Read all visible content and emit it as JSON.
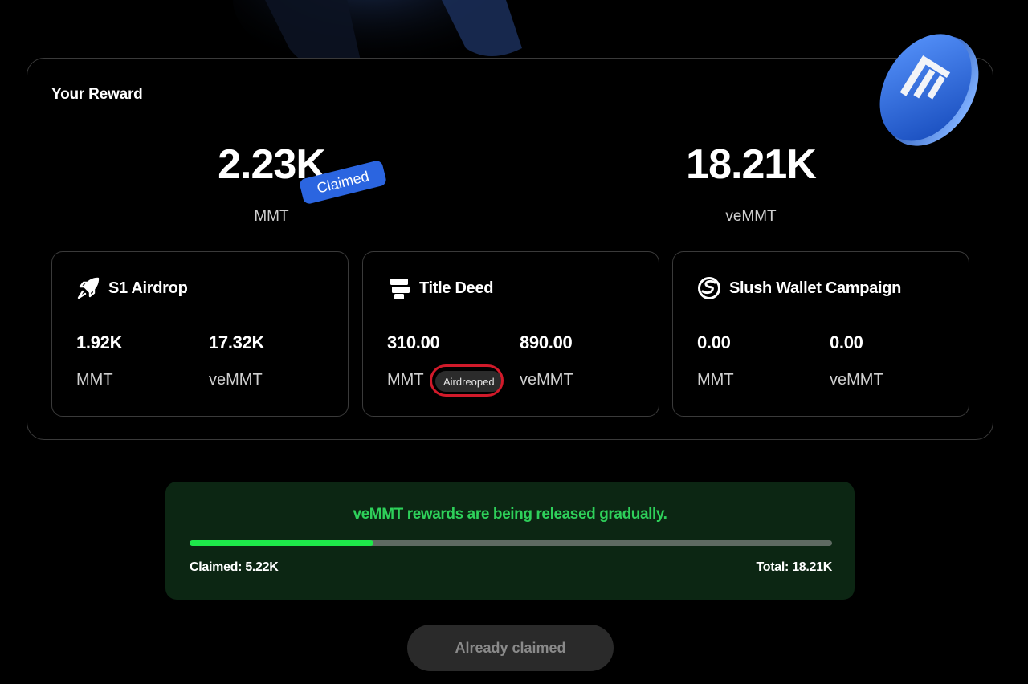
{
  "reward": {
    "title": "Your Reward",
    "mmt_value": "2.23K",
    "mmt_unit": "MMT",
    "claimed_badge": "Claimed",
    "vemmt_value": "18.21K",
    "vemmt_unit": "veMMT"
  },
  "cards": [
    {
      "title": "S1 Airdrop",
      "icon": "rocket-icon",
      "mmt": "1.92K",
      "mmt_unit": "MMT",
      "vemmt": "17.32K",
      "vemmt_unit": "veMMT"
    },
    {
      "title": "Title Deed",
      "icon": "signpost-icon",
      "mmt": "310.00",
      "mmt_unit": "MMT",
      "badge": "Airdreoped",
      "vemmt": "890.00",
      "vemmt_unit": "veMMT"
    },
    {
      "title": "Slush Wallet Campaign",
      "icon": "slush-icon",
      "mmt": "0.00",
      "mmt_unit": "MMT",
      "vemmt": "0.00",
      "vemmt_unit": "veMMT"
    }
  ],
  "progress": {
    "message": "veMMT rewards are being released gradually.",
    "claimed_label": "Claimed: 5.22K",
    "total_label": "Total: 18.21K",
    "fraction": 0.2866
  },
  "button": {
    "label": "Already claimed"
  },
  "colors": {
    "accent_blue": "#2b65e0",
    "progress_green": "#1ee84a",
    "message_green": "#2ed05a",
    "highlight_red": "#d11a2a"
  }
}
